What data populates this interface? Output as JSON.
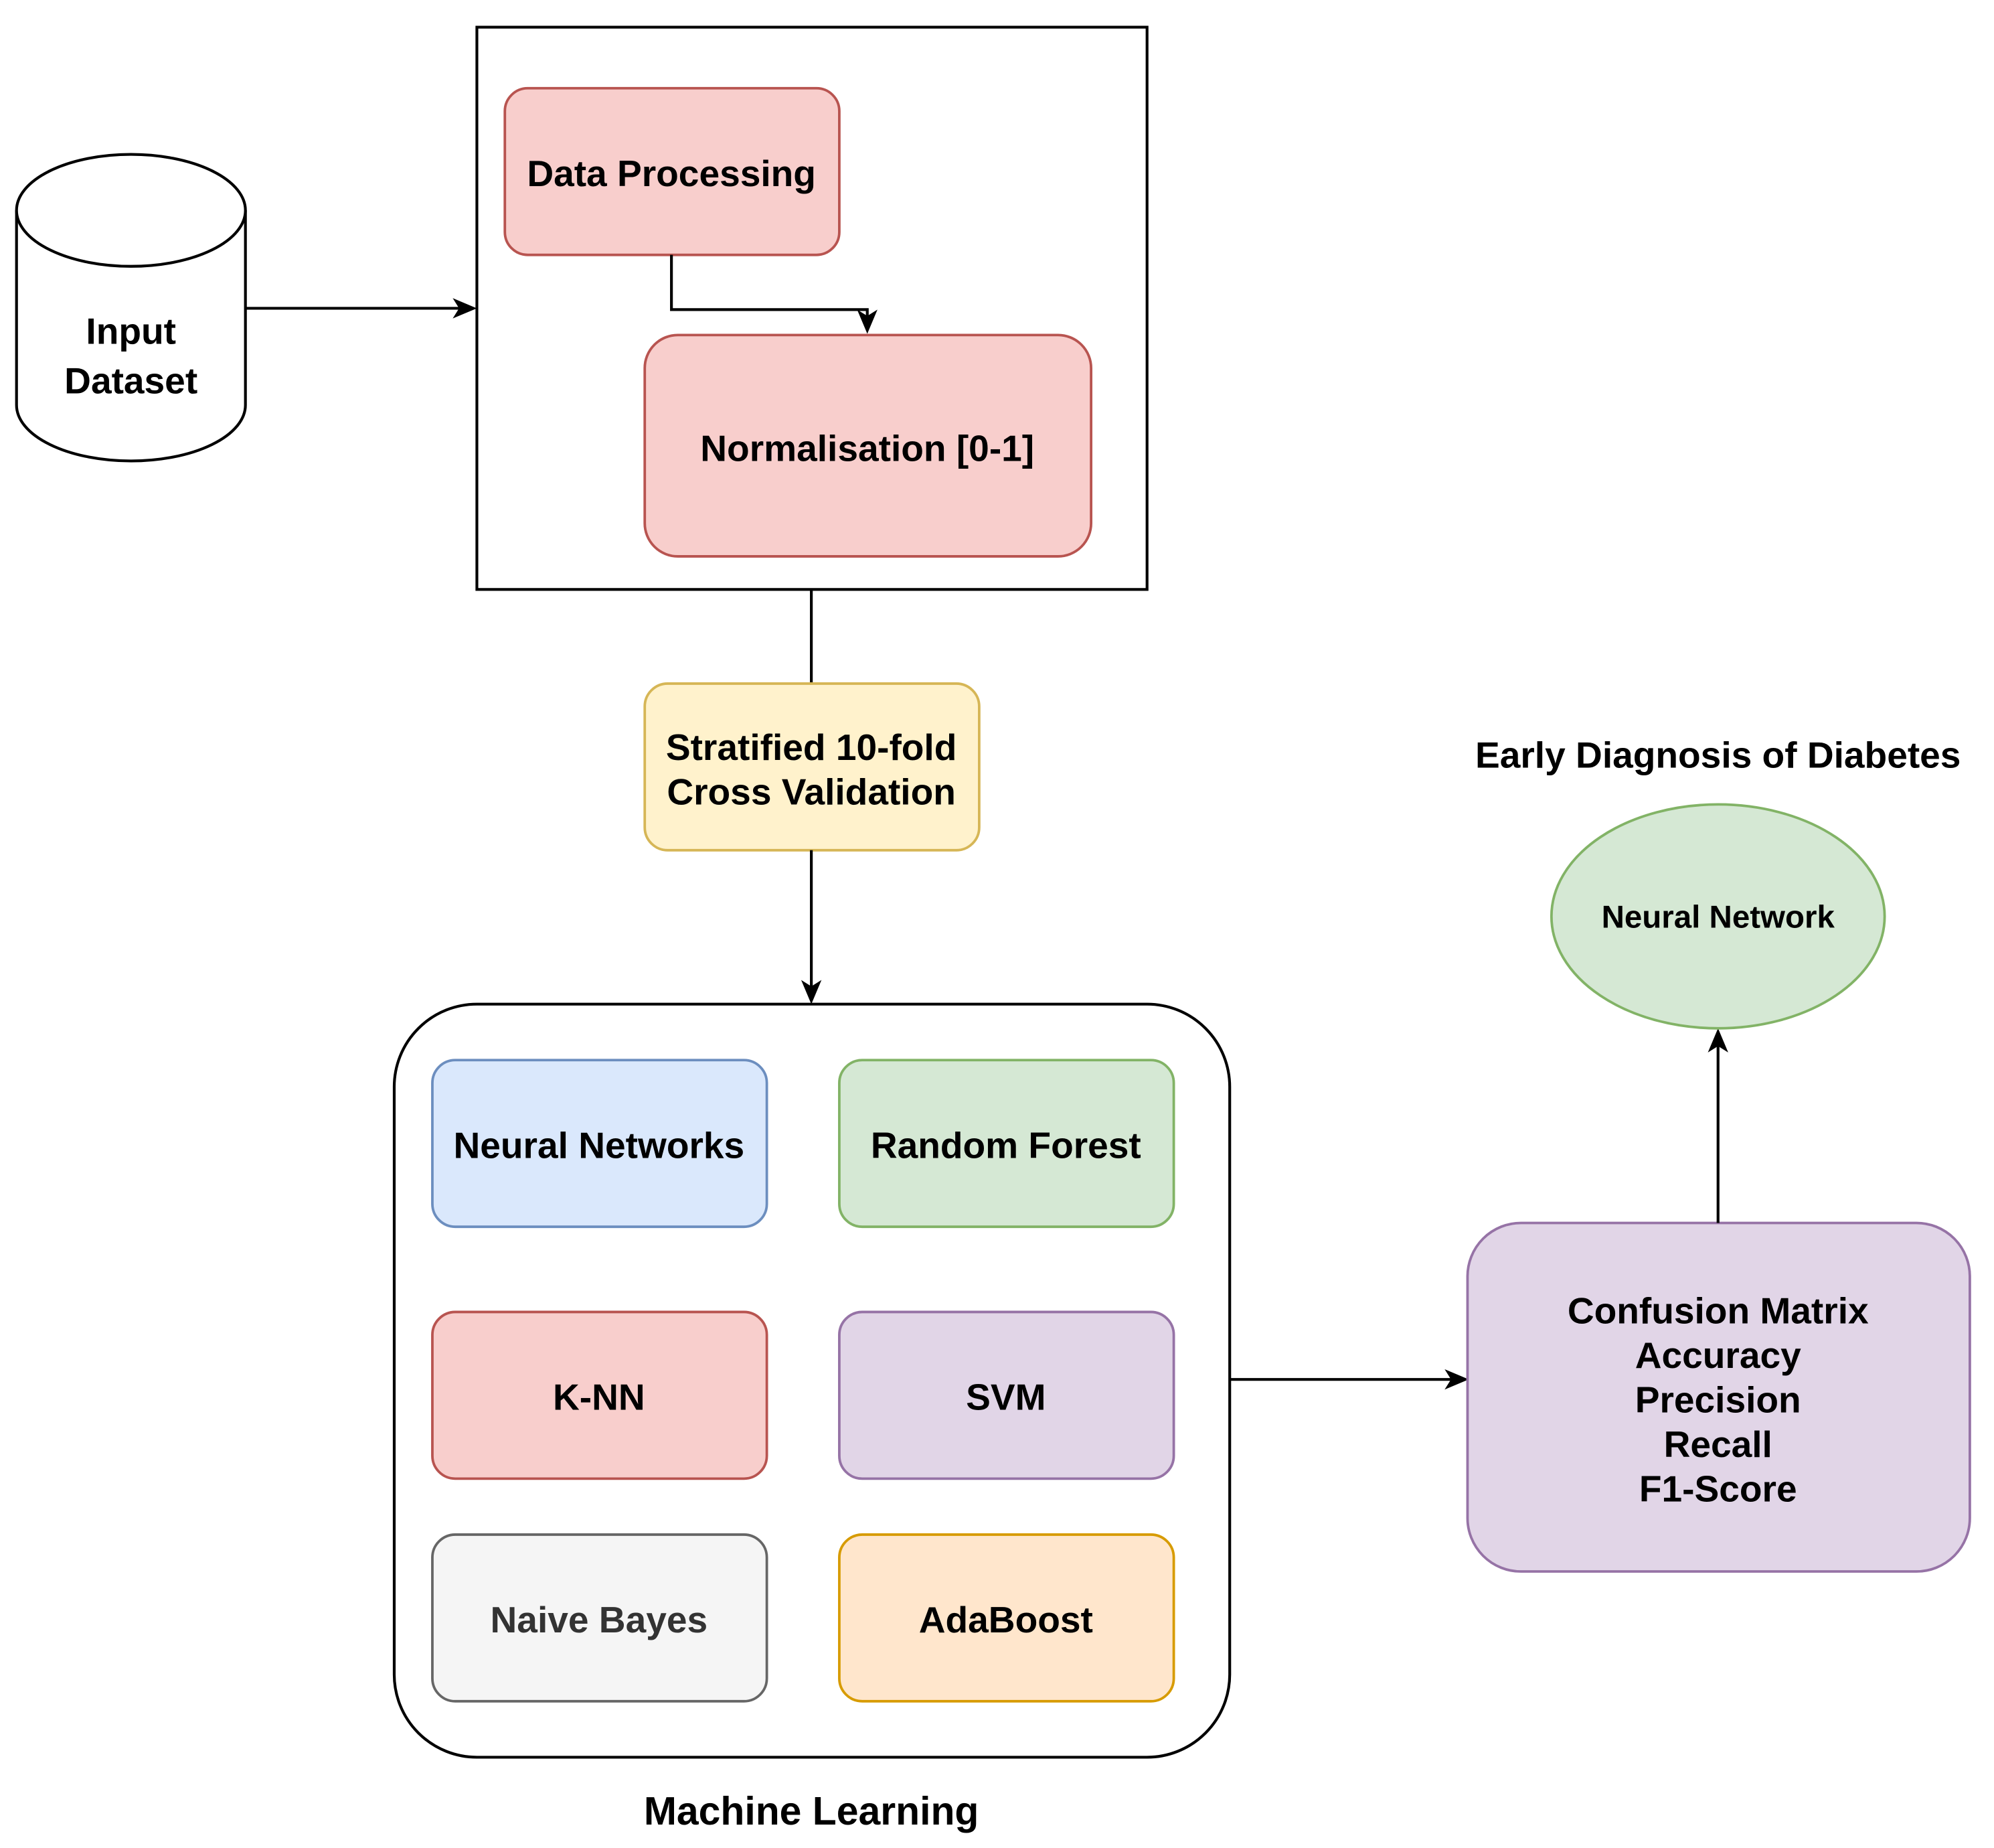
{
  "diagram": {
    "input": {
      "line1": "Input",
      "line2": "Dataset"
    },
    "preprocessing": {
      "data_processing": "Data Processing",
      "normalisation": "Normalisation [0-1]"
    },
    "cross_validation": {
      "line1": "Stratified 10-fold",
      "line2": "Cross Validation"
    },
    "machine_learning": {
      "label": "Machine Learning",
      "models": [
        {
          "name": "Neural Networks",
          "fill": "#dae8fc",
          "stroke": "#6c8ebf",
          "text": "#000000"
        },
        {
          "name": "Random Forest",
          "fill": "#d5e8d4",
          "stroke": "#82b366",
          "text": "#000000"
        },
        {
          "name": "K-NN",
          "fill": "#f8cecc",
          "stroke": "#b85450",
          "text": "#000000"
        },
        {
          "name": "SVM",
          "fill": "#e1d5e7",
          "stroke": "#9673a6",
          "text": "#000000"
        },
        {
          "name": "Naive Bayes",
          "fill": "#f5f5f5",
          "stroke": "#666666",
          "text": "#333333"
        },
        {
          "name": "AdaBoost",
          "fill": "#ffe6cc",
          "stroke": "#d79b00",
          "text": "#000000"
        }
      ]
    },
    "evaluation": {
      "metrics": [
        "Confusion Matrix",
        "Accuracy",
        "Precision",
        "Recall",
        "F1-Score"
      ]
    },
    "result": {
      "title": "Early Diagnosis of Diabetes",
      "best_model": "Neural Network"
    },
    "colors": {
      "red_fill": "#f8cecc",
      "red_stroke": "#b85450",
      "yellow_fill": "#fff2cc",
      "yellow_stroke": "#d6b656",
      "purple_fill": "#e1d5e7",
      "purple_stroke": "#9673a6",
      "green_fill": "#d5e8d4",
      "green_stroke": "#82b366"
    }
  }
}
